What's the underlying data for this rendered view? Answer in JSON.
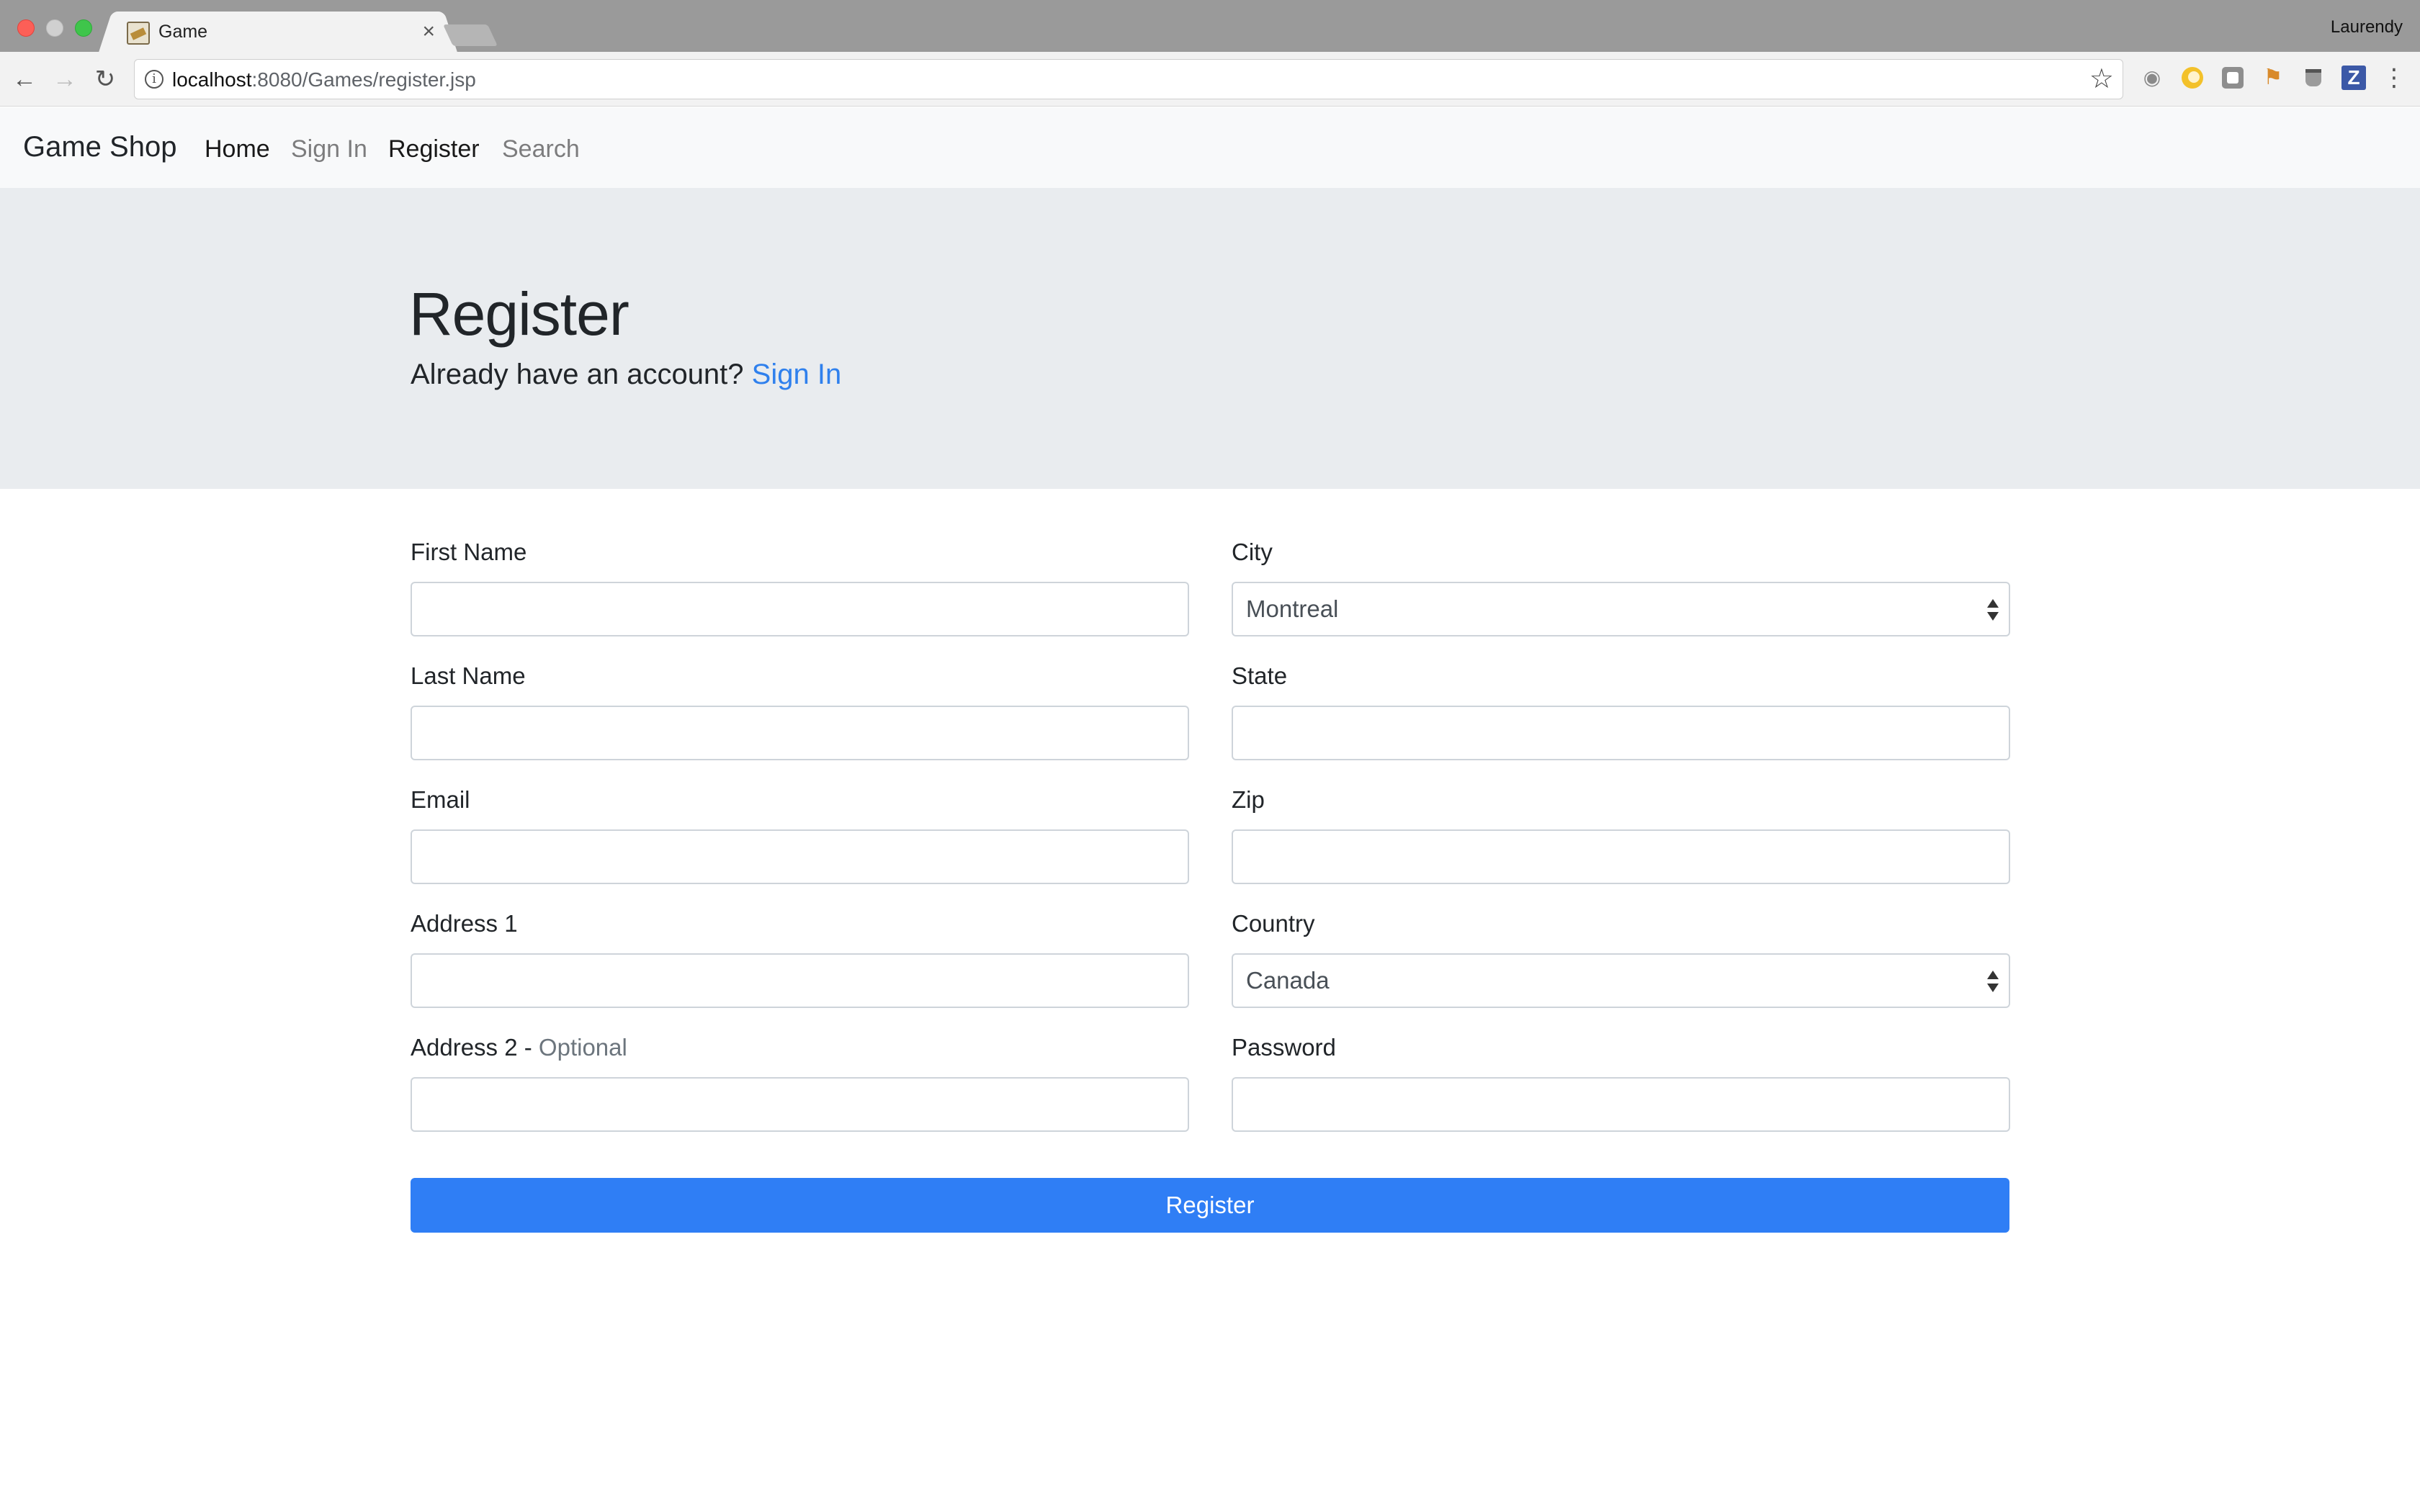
{
  "browser": {
    "tab_title": "Game",
    "tab_close": "×",
    "profile_name": "Laurendy",
    "url_host": "localhost",
    "url_rest": ":8080/Games/register.jsp",
    "icons": [
      "back-arrow-icon",
      "forward-arrow-icon",
      "reload-icon",
      "info-icon",
      "star-icon",
      "camera-icon",
      "moon-icon",
      "box-icon",
      "flag-icon",
      "cup-icon",
      "zotero-icon",
      "menu-icon"
    ]
  },
  "navbar": {
    "brand": "Game Shop",
    "links": [
      "Home",
      "Sign In",
      "Register",
      "Search"
    ]
  },
  "hero": {
    "title": "Register",
    "lead_text": "Already have an account?",
    "lead_link": "Sign In"
  },
  "form": {
    "first_name": {
      "label": "First Name",
      "value": ""
    },
    "last_name": {
      "label": "Last Name",
      "value": ""
    },
    "email": {
      "label": "Email",
      "value": ""
    },
    "address1": {
      "label": "Address 1",
      "value": ""
    },
    "address2": {
      "label": "Address 2 - ",
      "optional": "Optional",
      "value": ""
    },
    "city": {
      "label": "City",
      "selected": "Montreal"
    },
    "state": {
      "label": "State",
      "value": ""
    },
    "zip": {
      "label": "Zip",
      "value": ""
    },
    "country": {
      "label": "Country",
      "selected": "Canada"
    },
    "password": {
      "label": "Password",
      "value": ""
    },
    "submit_label": "Register"
  },
  "colors": {
    "primary": "#2f7ef5",
    "link": "#2f80ed",
    "jumbotron_bg": "#e9ecef",
    "navbar_bg": "#f8f9fa"
  }
}
